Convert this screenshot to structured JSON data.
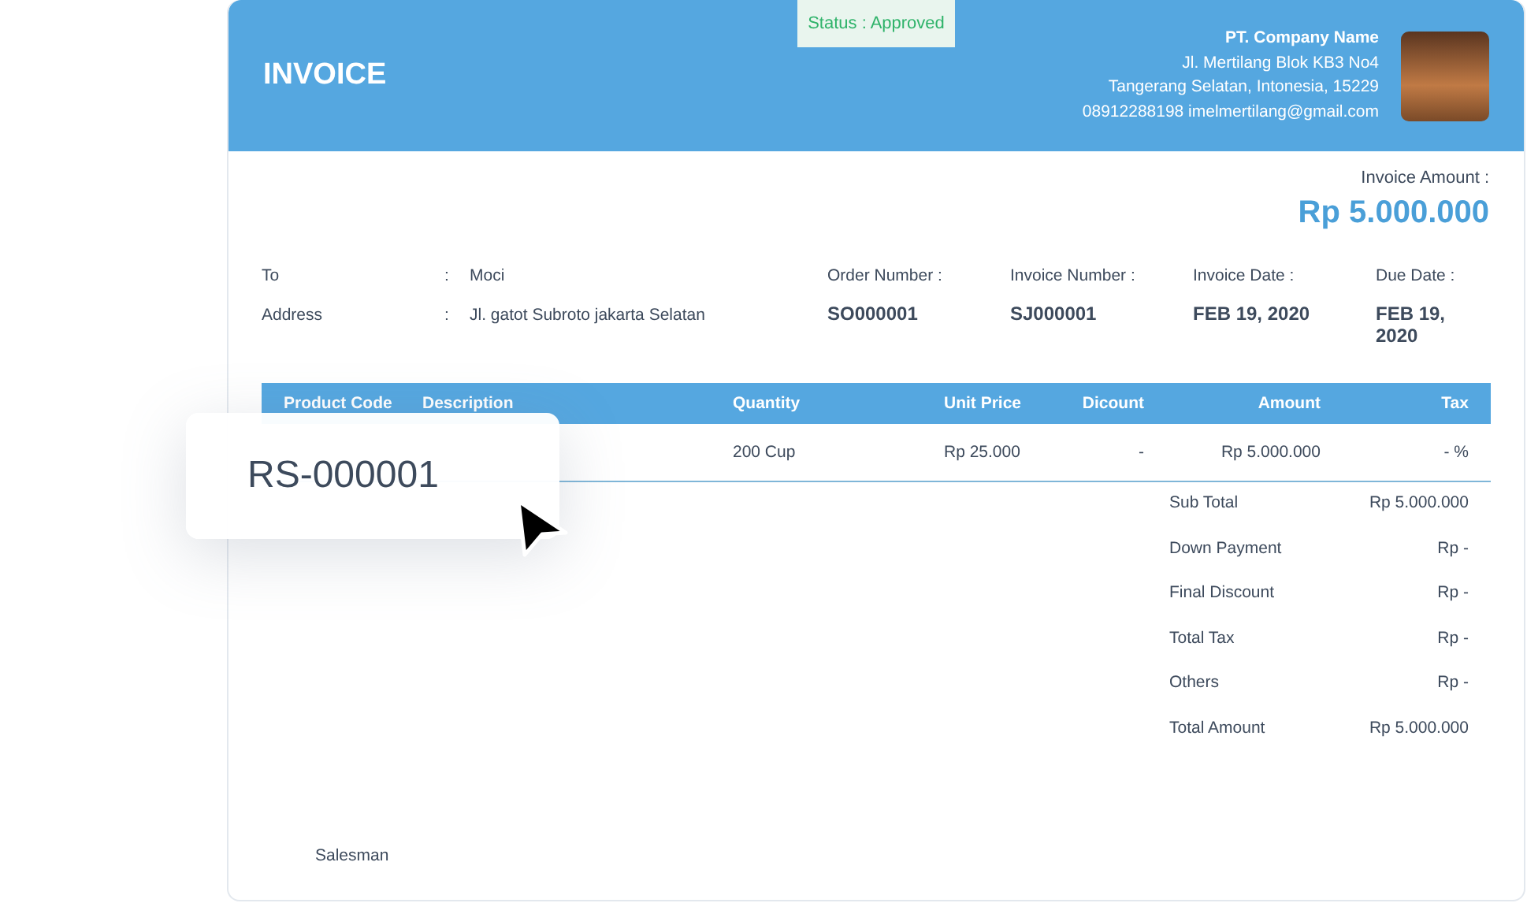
{
  "header": {
    "title": "INVOICE",
    "status": "Status : Approved",
    "company": {
      "name": "PT. Company Name",
      "address_lines": [
        "Jl. Mertilang Blok KB3 No4",
        "Tangerang Selatan, Intonesia, 15229"
      ],
      "contact": "08912288198 imelmertilang@gmail.com"
    }
  },
  "invoice_amount": {
    "label": "Invoice Amount :",
    "value": "Rp 5.000.000"
  },
  "customer": [
    {
      "label": "To",
      "separator": ":",
      "value": "Moci"
    },
    {
      "label": "Address",
      "separator": ":",
      "value": "Jl. gatot Subroto jakarta Selatan"
    }
  ],
  "meta": [
    {
      "label": "Order Number :",
      "value": "SO000001"
    },
    {
      "label": "Invoice Number :",
      "value": "SJ000001"
    },
    {
      "label": "Invoice Date :",
      "value": "FEB 19, 2020"
    },
    {
      "label": "Due Date :",
      "value": "FEB 19, 2020"
    }
  ],
  "table": {
    "columns": [
      "Product Code",
      "Description",
      "Quantity",
      "Unit Price",
      "Dicount",
      "Amount",
      "Tax"
    ],
    "rows": [
      [
        "",
        "",
        "200 Cup",
        "Rp 25.000",
        "-",
        "Rp 5.000.000",
        "- %"
      ]
    ]
  },
  "totals": [
    {
      "label": "Sub Total",
      "value": "Rp 5.000.000"
    },
    {
      "label": "Down Payment",
      "value": "Rp -"
    },
    {
      "label": "Final Discount",
      "value": "Rp -"
    },
    {
      "label": "Total Tax",
      "value": "Rp -"
    },
    {
      "label": "Others",
      "value": "Rp -"
    },
    {
      "label": "Total Amount",
      "value": "Rp 5.000.000"
    }
  ],
  "signature": {
    "label": "Salesman"
  },
  "overlay_card": {
    "text": "RS-000001"
  }
}
